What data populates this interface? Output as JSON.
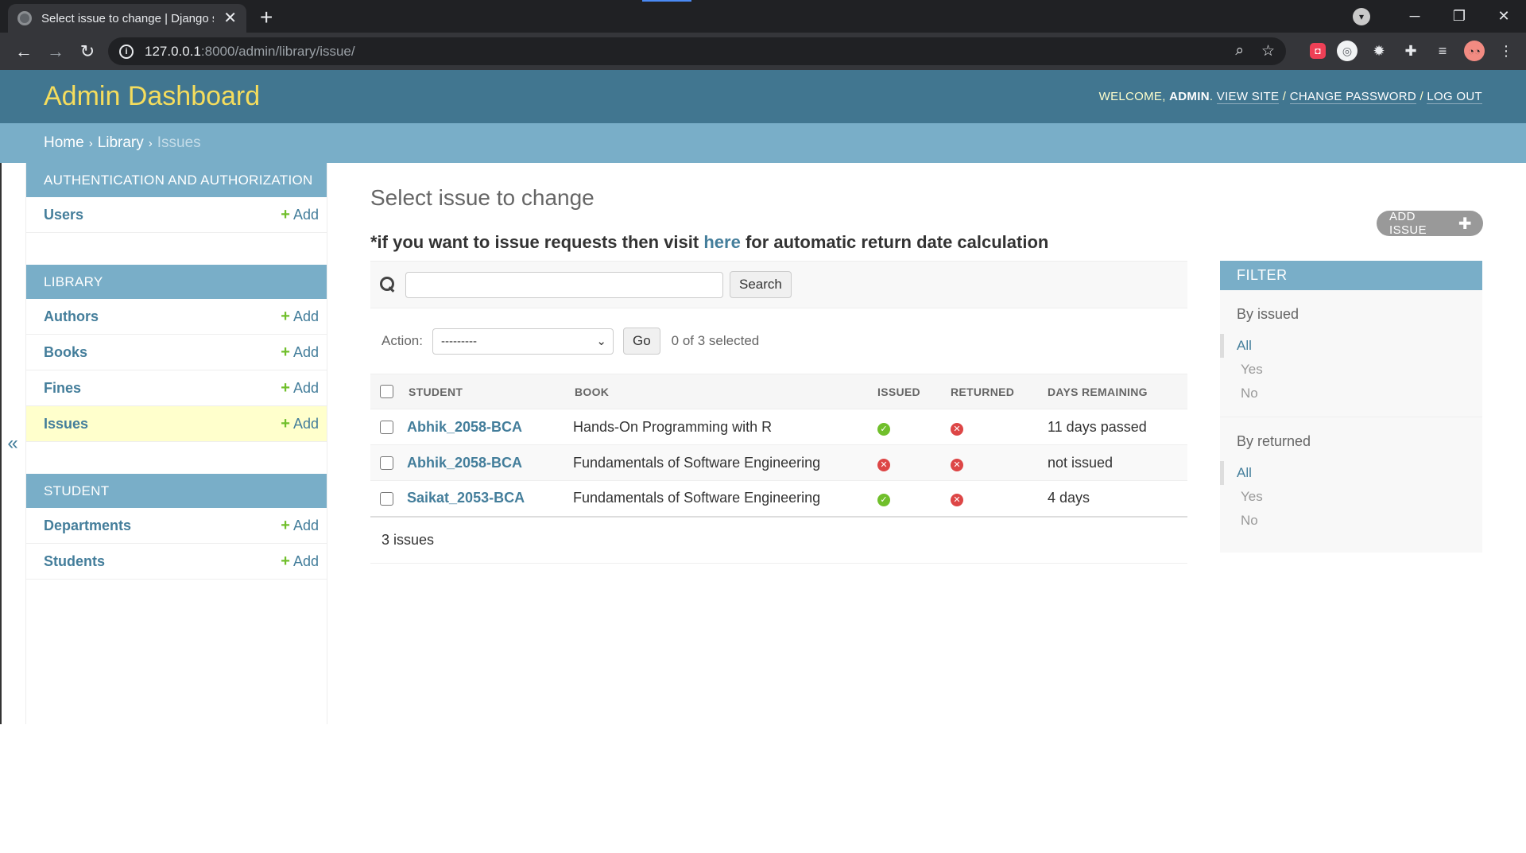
{
  "browser": {
    "tab_title": "Select issue to change | Django s",
    "url_host": "127.0.0.1",
    "url_rest": ":8000/admin/library/issue/"
  },
  "header": {
    "site_name": "Admin Dashboard",
    "welcome": "WELCOME,",
    "username": "ADMIN",
    "view_site": "VIEW SITE",
    "change_password": "CHANGE PASSWORD",
    "log_out": "LOG OUT"
  },
  "breadcrumbs": [
    "Home",
    "Library",
    "Issues"
  ],
  "sidebar": {
    "modules": [
      {
        "caption": "AUTHENTICATION AND AUTHORIZATION",
        "rows": [
          {
            "label": "Users",
            "add": "Add"
          }
        ]
      },
      {
        "caption": "LIBRARY",
        "rows": [
          {
            "label": "Authors",
            "add": "Add"
          },
          {
            "label": "Books",
            "add": "Add"
          },
          {
            "label": "Fines",
            "add": "Add"
          },
          {
            "label": "Issues",
            "add": "Add"
          }
        ]
      },
      {
        "caption": "STUDENT",
        "rows": [
          {
            "label": "Departments",
            "add": "Add"
          },
          {
            "label": "Students",
            "add": "Add"
          }
        ]
      }
    ],
    "current": "Issues"
  },
  "content": {
    "heading": "Select issue to change",
    "notice_prefix": "*if you want to issue requests then visit",
    "notice_link": "here",
    "notice_suffix": "for automatic return date calculation",
    "add_button": "ADD ISSUE",
    "search_button": "Search",
    "search_value": "",
    "action_label": "Action:",
    "action_selected": "---------",
    "go_button": "Go",
    "selected_count": "0 of 3 selected",
    "columns": [
      "STUDENT",
      "BOOK",
      "ISSUED",
      "RETURNED",
      "DAYS REMAINING"
    ],
    "rows": [
      {
        "student": "Abhik_2058-BCA",
        "book": "Hands-On Programming with R",
        "issued": true,
        "returned": false,
        "days": "11 days passed"
      },
      {
        "student": "Abhik_2058-BCA",
        "book": "Fundamentals of Software Engineering",
        "issued": false,
        "returned": false,
        "days": "not issued"
      },
      {
        "student": "Saikat_2053-BCA",
        "book": "Fundamentals of Software Engineering",
        "issued": true,
        "returned": false,
        "days": "4 days"
      }
    ],
    "paginator": "3 issues"
  },
  "filter": {
    "title": "FILTER",
    "groups": [
      {
        "title": "By issued",
        "options": [
          "All",
          "Yes",
          "No"
        ],
        "selected": "All"
      },
      {
        "title": "By returned",
        "options": [
          "All",
          "Yes",
          "No"
        ],
        "selected": "All"
      }
    ]
  },
  "colors": {
    "header_bg": "#417690",
    "breadcrumb_bg": "#79aec8",
    "site_name": "#f5dd5d",
    "link": "#447e9b",
    "add_green": "#70bf2b",
    "no_red": "#dd4646",
    "current_row": "#ffffcc"
  }
}
